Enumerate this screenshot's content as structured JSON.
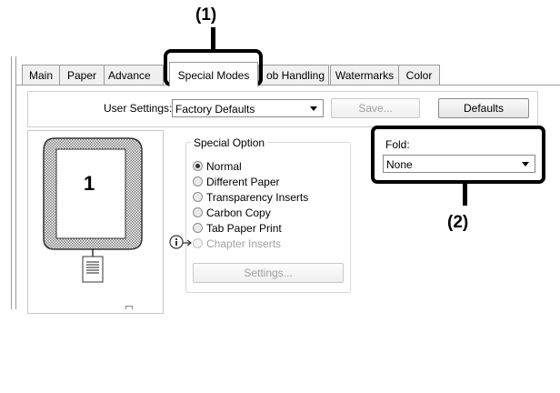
{
  "callouts": {
    "one": "(1)",
    "two": "(2)"
  },
  "tabs": [
    {
      "label": "Main"
    },
    {
      "label": "Paper"
    },
    {
      "label": "Advance"
    },
    {
      "label": "Special Modes"
    },
    {
      "label": "ob Handling"
    },
    {
      "label": "Watermarks"
    },
    {
      "label": "Color"
    }
  ],
  "user_settings": {
    "label": "User Settings:",
    "selected": "Factory Defaults",
    "save_label": "Save...",
    "defaults_label": "Defaults"
  },
  "preview": {
    "page_number": "1"
  },
  "special_option": {
    "title": "Special Option",
    "options": [
      {
        "label": "Normal",
        "checked": true,
        "disabled": false
      },
      {
        "label": "Different Paper",
        "checked": false,
        "disabled": false
      },
      {
        "label": "Transparency Inserts",
        "checked": false,
        "disabled": false
      },
      {
        "label": "Carbon Copy",
        "checked": false,
        "disabled": false
      },
      {
        "label": "Tab Paper Print",
        "checked": false,
        "disabled": false
      },
      {
        "label": "Chapter Inserts",
        "checked": false,
        "disabled": true
      }
    ],
    "settings_button": "Settings..."
  },
  "fold": {
    "label": "Fold:",
    "selected": "None"
  },
  "colors": {
    "accent": "#000000",
    "border": "#9a9a9a"
  }
}
